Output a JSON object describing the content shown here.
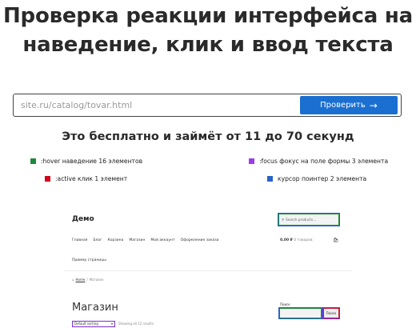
{
  "hero": {
    "title_line1": "Проверка реакции интерфейса на",
    "title_line2": "наведение, клик и ввод текста"
  },
  "form": {
    "placeholder": "site.ru/catalog/tovar.html",
    "button_label": "Проверить",
    "button_icon": "arrow-right-icon"
  },
  "subtitle": "Это бесплатно и займёт от 11 до 70 секунд",
  "legend": [
    {
      "label": ":hover наведение 16 элементов",
      "color": "#1e8a3a"
    },
    {
      "label": ":focus фокус на поле формы 3 элемента",
      "color": "#9b3ee8"
    },
    {
      "label": ":active клик 1 элемент",
      "color": "#d0021b"
    },
    {
      "label": "курсор поинтер 2 элемента",
      "color": "#2a62c9"
    }
  ],
  "demo": {
    "logo": "Демо",
    "search_placeholder": "Search products…",
    "nav": [
      "Главная",
      "Блог",
      "Корзина",
      "Магазин",
      "Мой аккаунт",
      "Оформление заказа"
    ],
    "nav_second": "Пример страницы",
    "cart_price": "0,00 ₽",
    "cart_count": "0 товаров",
    "breadcrumb_home": "Home",
    "breadcrumb_sep": "/",
    "breadcrumb_current": "Магазин",
    "heading": "Магазин",
    "sort_label": "Default sorting",
    "results_text": "Showing all 12 results",
    "search_label": "Поиск",
    "search_button": "Поиск"
  }
}
